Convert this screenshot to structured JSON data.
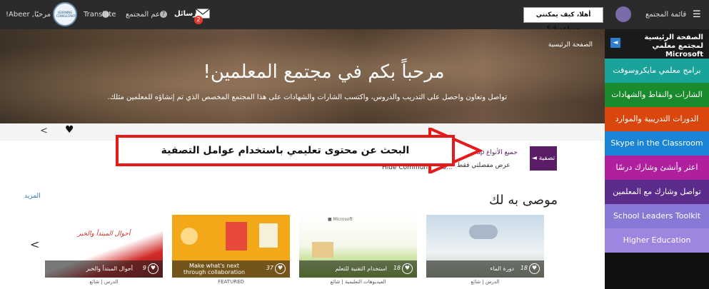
{
  "topbar": {
    "greeting_user": "!Abeer ,مرحبًا",
    "badge_text": "LEARNING CONSULTANT",
    "translate_label": "Translate",
    "support_label": "دعم المجتمع",
    "messages_label": "الرسائل",
    "messages_count": "2",
    "help_prompt": "أهلا، كيف يمكنني مساعدتك؟",
    "community_menu_label": "قائمة المجتمع"
  },
  "sidebar": {
    "title": "الصفحة الرئيسية لمجتمع معلمي Microsoft",
    "collapse_glyph": "◄",
    "items": [
      {
        "label": "برامج معلمي مايكروسوفت",
        "color": "#1aa39a"
      },
      {
        "label": "الشارات والنقاط والشهادات",
        "color": "#1a8a2e"
      },
      {
        "label": "الدورات التدريبية والموارد",
        "color": "#d9470f"
      },
      {
        "label": "Skype in the Classroom",
        "color": "#1a85d6"
      },
      {
        "label": "اعثر وأنشئ وشارك درسًا",
        "color": "#b01f9e"
      },
      {
        "label": "تواصل وشارك مع المعلمين",
        "color": "#5b2c8c"
      },
      {
        "label": "School Leaders Toolkit",
        "color": "#8a78d6"
      },
      {
        "label": "Higher Education",
        "color": "#9c86e0"
      }
    ]
  },
  "hero": {
    "breadcrumb": "الصفحة الرئيسية",
    "title": "مرحباً بكم في مجتمع المعلمين!",
    "subtitle": "تواصل وتعاون واحصل على التدريب والدروس، واكتسب الشارات والشهادات على هذا المجتمع المخصص الذي تم إنشاؤه للمعلمين مثلك."
  },
  "filters": {
    "filter_button": "تصفية",
    "all_types": "جميع الأنواع",
    "group_label": "Group",
    "favorites_only": "عرض مفضلتي فقط",
    "hide_label": "Hide Community Co..."
  },
  "annotation": {
    "banner_text": "البحث عن محتوى تعليمي باستخدام عوامل التصفية",
    "color": "#e51b1b"
  },
  "recommended": {
    "title": "موصى به لك",
    "more_link": "المزيد",
    "cards": [
      {
        "title": "دورة الماء",
        "count": "18",
        "meta": "الدرس | شائع"
      },
      {
        "title": "استخدام التقنية للتعلم",
        "count": "18",
        "meta": "الفيديوهات التعليمية | شائع"
      },
      {
        "title": "Make what's next through collaboration",
        "count": "37",
        "meta": "FEATURED"
      },
      {
        "title": "أحوال المبتدأ والخبر",
        "count": "9",
        "meta": "الدرس | شائع"
      }
    ],
    "card4_heading": "أحوال المبتدأ والخبر"
  }
}
